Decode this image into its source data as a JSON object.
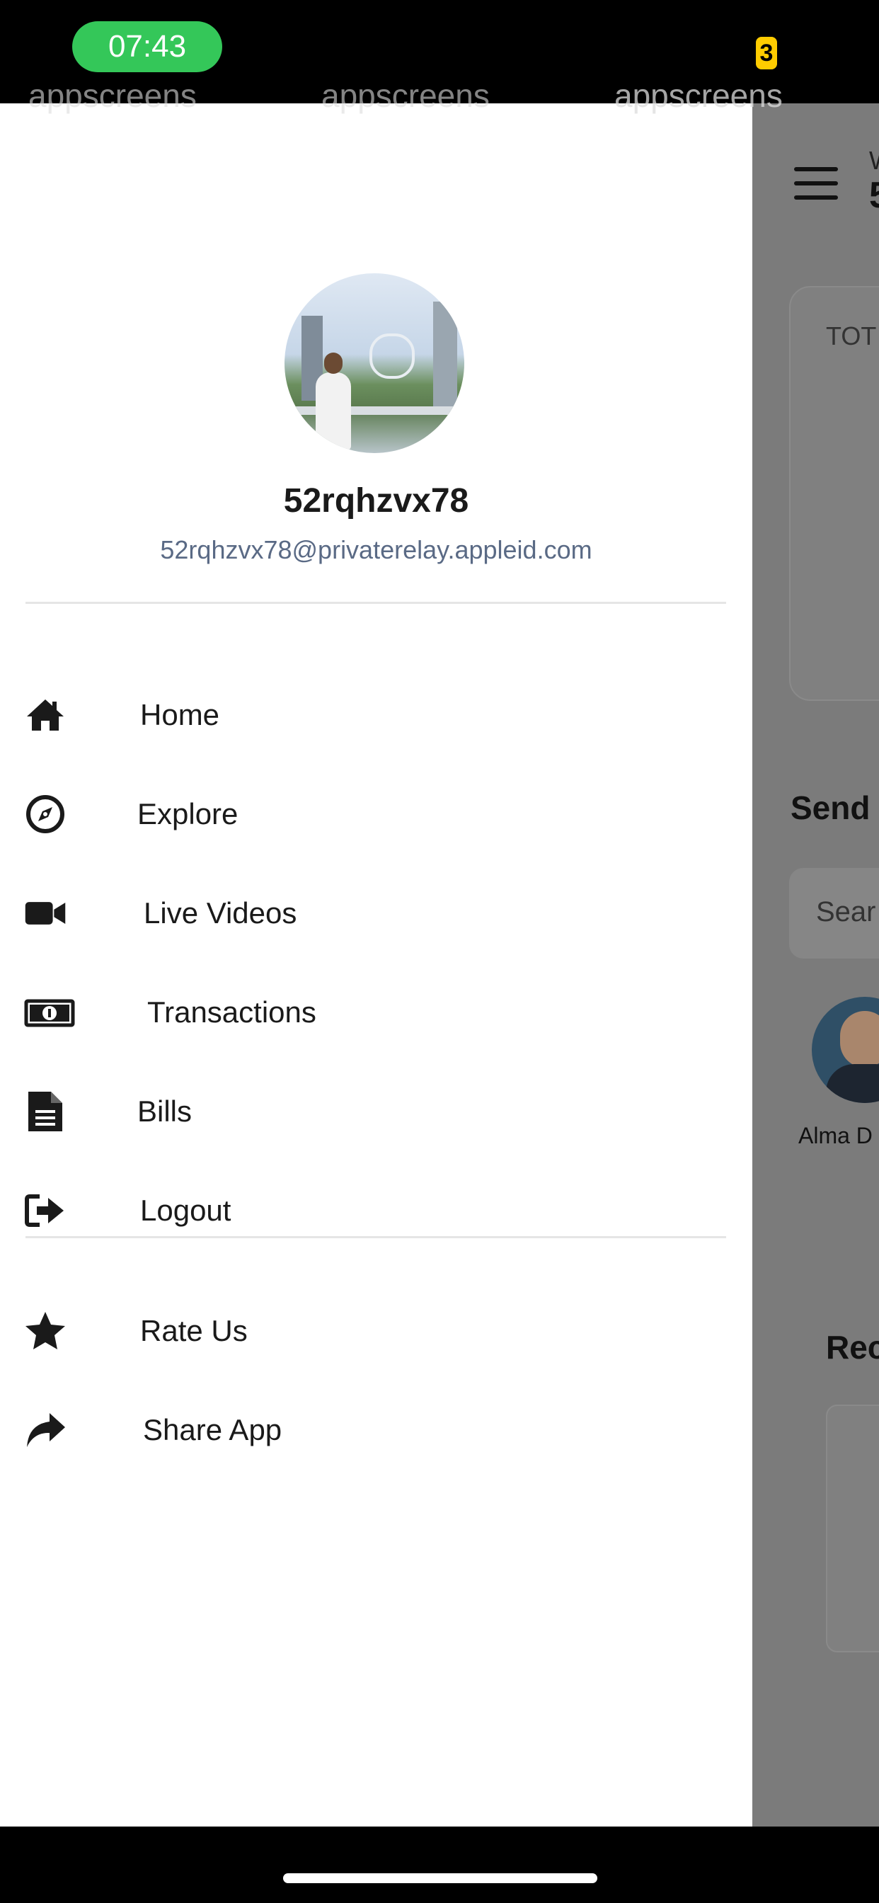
{
  "status_bar": {
    "time": "07:43",
    "battery_badge": "3"
  },
  "watermark": "appscreens",
  "drawer": {
    "profile": {
      "username": "52rqhzvx78",
      "email": "52rqhzvx78@privaterelay.appleid.com"
    },
    "menu": [
      {
        "label": "Home",
        "icon": "home-icon"
      },
      {
        "label": "Explore",
        "icon": "compass-icon"
      },
      {
        "label": "Live Videos",
        "icon": "video-camera-icon"
      },
      {
        "label": "Transactions",
        "icon": "money-bill-icon"
      },
      {
        "label": "Bills",
        "icon": "file-document-icon"
      },
      {
        "label": "Logout",
        "icon": "sign-out-icon"
      }
    ],
    "secondary_menu": [
      {
        "label": "Rate Us",
        "icon": "star-icon"
      },
      {
        "label": "Share App",
        "icon": "share-arrow-icon"
      }
    ]
  },
  "background_screen": {
    "greeting_partial": "W",
    "name_partial": "5",
    "card_label_partial": "TOT",
    "send_title_partial": "Send",
    "search_placeholder_partial": "Sear",
    "contact_name_partial": "Alma D",
    "recent_title_partial": "Rec"
  },
  "colors": {
    "status_pill": "#34c759",
    "battery_badge": "#ffcc00",
    "drawer_bg": "#ffffff",
    "overlay": "#7b7b7b",
    "email_text": "#5a6a85"
  }
}
